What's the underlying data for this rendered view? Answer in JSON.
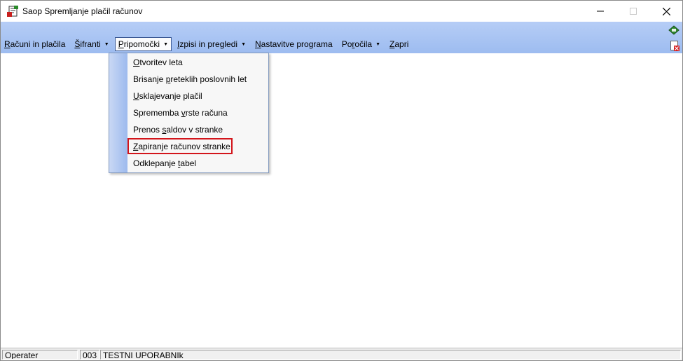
{
  "window": {
    "title": "Saop Spremljanje plačil računov"
  },
  "menu": {
    "items": [
      {
        "pre": "",
        "mn": "R",
        "post": "ačuni in plačila",
        "arrow": false
      },
      {
        "pre": "",
        "mn": "Š",
        "post": "ifranti",
        "arrow": true
      },
      {
        "pre": "",
        "mn": "P",
        "post": "ripomočki",
        "arrow": true
      },
      {
        "pre": "",
        "mn": "I",
        "post": "zpisi in pregledi",
        "arrow": true
      },
      {
        "pre": "",
        "mn": "N",
        "post": "astavitve programa",
        "arrow": false
      },
      {
        "pre": "Po",
        "mn": "r",
        "post": "očila",
        "arrow": true
      },
      {
        "pre": "",
        "mn": "Z",
        "post": "apri",
        "arrow": false
      }
    ]
  },
  "dropdown": {
    "items": [
      {
        "pre": "",
        "mn": "O",
        "post": "tvoritev leta"
      },
      {
        "pre": "Brisanje ",
        "mn": "p",
        "post": "reteklih poslovnih let"
      },
      {
        "pre": "",
        "mn": "U",
        "post": "sklajevanje plačil"
      },
      {
        "pre": "Sprememba ",
        "mn": "v",
        "post": "rste računa"
      },
      {
        "pre": "Prenos ",
        "mn": "s",
        "post": "aldov v stranke"
      },
      {
        "pre": "",
        "mn": "Z",
        "post": "apiranje računov stranke"
      },
      {
        "pre": "Odklepanje ",
        "mn": "t",
        "post": "abel"
      }
    ],
    "highlighted_index": 5
  },
  "statusbar": {
    "operator_label": "Operater",
    "operator_code": "003",
    "operator_name": "TESTNI UPORABNIk"
  },
  "colors": {
    "menubar": "#a8c4f2",
    "highlight": "#d3151b",
    "active_border": "#3c5a96"
  }
}
